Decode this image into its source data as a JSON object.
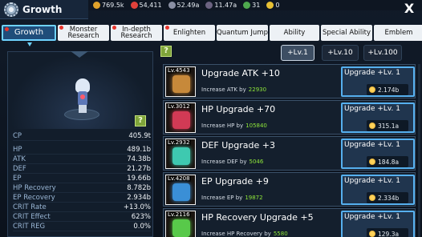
{
  "window": {
    "title": "Growth",
    "close_label": "X"
  },
  "currencies": [
    {
      "icon": "gold-coin-icon",
      "color": "#e0a22b",
      "value": "769.5k"
    },
    {
      "icon": "red-gem-icon",
      "color": "#e0413a",
      "value": "54,411"
    },
    {
      "icon": "shard-icon",
      "color": "#8a8fa3",
      "value": "52.49a"
    },
    {
      "icon": "dark-orb-icon",
      "color": "#6b6280",
      "value": "11.47a"
    },
    {
      "icon": "green-orb-icon",
      "color": "#4ea84e",
      "value": "31"
    },
    {
      "icon": "gold-bar-icon",
      "color": "#e7c034",
      "value": "0"
    }
  ],
  "tabs": [
    {
      "label": "Growth",
      "dot": true
    },
    {
      "label": "Monster Research",
      "dot": true
    },
    {
      "label": "In-depth Research",
      "dot": true
    },
    {
      "label": "Enlighten",
      "dot": true
    },
    {
      "label": "Quantum Jump",
      "dot": false
    },
    {
      "label": "Ability",
      "dot": false
    },
    {
      "label": "Special Ability",
      "dot": false
    },
    {
      "label": "Emblem",
      "dot": false
    }
  ],
  "help_label": "?",
  "stats": [
    {
      "k": "CP",
      "v": "405.9t"
    },
    {
      "k": "HP",
      "v": "489.1b"
    },
    {
      "k": "ATK",
      "v": "74.38b"
    },
    {
      "k": "DEF",
      "v": "21.27b"
    },
    {
      "k": "EP",
      "v": "19.66b"
    },
    {
      "k": "HP Recovery",
      "v": "8.782b"
    },
    {
      "k": "EP Recovery",
      "v": "2.934b"
    },
    {
      "k": "CRIT Rate",
      "v": "+13.0%"
    },
    {
      "k": "CRIT Effect",
      "v": "623%"
    },
    {
      "k": "CRIT REG",
      "v": "0.0%"
    }
  ],
  "level_buttons": [
    "+Lv.1",
    "+Lv.10",
    "+Lv.100"
  ],
  "upgrades": [
    {
      "level": "Lv.4543",
      "name": "Upgrade ATK +10",
      "desc": "Increase ATK by",
      "amount": "22930",
      "button": "Upgrade +Lv. 1",
      "price": "2.174b",
      "art_color": "#c7893a"
    },
    {
      "level": "Lv.3012",
      "name": "HP Upgrade +70",
      "desc": "Increase HP by",
      "amount": "105840",
      "button": "Upgrade +Lv. 1",
      "price": "315.1a",
      "art_color": "#d23a55"
    },
    {
      "level": "Lv.2932",
      "name": "DEF Upgrade +3",
      "desc": "Increase DEF by",
      "amount": "5046",
      "button": "Upgrade +Lv. 1",
      "price": "184.8a",
      "art_color": "#3ec9b0"
    },
    {
      "level": "Lv.4208",
      "name": "EP Upgrade +9",
      "desc": "Increase EP by",
      "amount": "19872",
      "button": "Upgrade +Lv. 1",
      "price": "2.334b",
      "art_color": "#3a8fd6"
    },
    {
      "level": "Lv.2116",
      "name": "HP Recovery Upgrade +5",
      "desc": "Increase HP Recovery by",
      "amount": "5580",
      "button": "Upgrade +Lv. 1",
      "price": "129.3a",
      "art_color": "#58c94a"
    }
  ]
}
